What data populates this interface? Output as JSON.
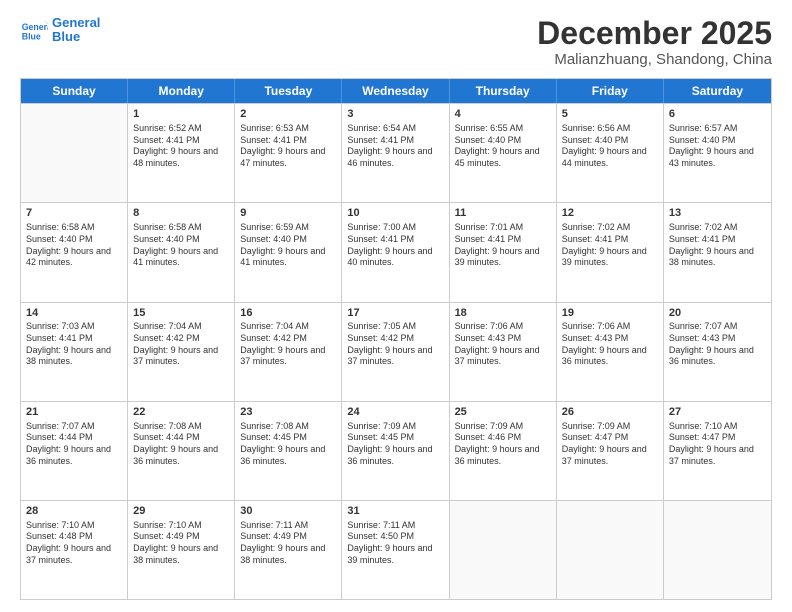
{
  "header": {
    "logo_line1": "General",
    "logo_line2": "Blue",
    "main_title": "December 2025",
    "subtitle": "Malianzhuang, Shandong, China"
  },
  "days_of_week": [
    "Sunday",
    "Monday",
    "Tuesday",
    "Wednesday",
    "Thursday",
    "Friday",
    "Saturday"
  ],
  "weeks": [
    [
      {
        "day": "",
        "empty": true
      },
      {
        "day": "1",
        "sunrise": "6:52 AM",
        "sunset": "4:41 PM",
        "daylight": "9 hours and 48 minutes."
      },
      {
        "day": "2",
        "sunrise": "6:53 AM",
        "sunset": "4:41 PM",
        "daylight": "9 hours and 47 minutes."
      },
      {
        "day": "3",
        "sunrise": "6:54 AM",
        "sunset": "4:41 PM",
        "daylight": "9 hours and 46 minutes."
      },
      {
        "day": "4",
        "sunrise": "6:55 AM",
        "sunset": "4:40 PM",
        "daylight": "9 hours and 45 minutes."
      },
      {
        "day": "5",
        "sunrise": "6:56 AM",
        "sunset": "4:40 PM",
        "daylight": "9 hours and 44 minutes."
      },
      {
        "day": "6",
        "sunrise": "6:57 AM",
        "sunset": "4:40 PM",
        "daylight": "9 hours and 43 minutes."
      }
    ],
    [
      {
        "day": "7",
        "sunrise": "6:58 AM",
        "sunset": "4:40 PM",
        "daylight": "9 hours and 42 minutes."
      },
      {
        "day": "8",
        "sunrise": "6:58 AM",
        "sunset": "4:40 PM",
        "daylight": "9 hours and 41 minutes."
      },
      {
        "day": "9",
        "sunrise": "6:59 AM",
        "sunset": "4:40 PM",
        "daylight": "9 hours and 41 minutes."
      },
      {
        "day": "10",
        "sunrise": "7:00 AM",
        "sunset": "4:41 PM",
        "daylight": "9 hours and 40 minutes."
      },
      {
        "day": "11",
        "sunrise": "7:01 AM",
        "sunset": "4:41 PM",
        "daylight": "9 hours and 39 minutes."
      },
      {
        "day": "12",
        "sunrise": "7:02 AM",
        "sunset": "4:41 PM",
        "daylight": "9 hours and 39 minutes."
      },
      {
        "day": "13",
        "sunrise": "7:02 AM",
        "sunset": "4:41 PM",
        "daylight": "9 hours and 38 minutes."
      }
    ],
    [
      {
        "day": "14",
        "sunrise": "7:03 AM",
        "sunset": "4:41 PM",
        "daylight": "9 hours and 38 minutes."
      },
      {
        "day": "15",
        "sunrise": "7:04 AM",
        "sunset": "4:42 PM",
        "daylight": "9 hours and 37 minutes."
      },
      {
        "day": "16",
        "sunrise": "7:04 AM",
        "sunset": "4:42 PM",
        "daylight": "9 hours and 37 minutes."
      },
      {
        "day": "17",
        "sunrise": "7:05 AM",
        "sunset": "4:42 PM",
        "daylight": "9 hours and 37 minutes."
      },
      {
        "day": "18",
        "sunrise": "7:06 AM",
        "sunset": "4:43 PM",
        "daylight": "9 hours and 37 minutes."
      },
      {
        "day": "19",
        "sunrise": "7:06 AM",
        "sunset": "4:43 PM",
        "daylight": "9 hours and 36 minutes."
      },
      {
        "day": "20",
        "sunrise": "7:07 AM",
        "sunset": "4:43 PM",
        "daylight": "9 hours and 36 minutes."
      }
    ],
    [
      {
        "day": "21",
        "sunrise": "7:07 AM",
        "sunset": "4:44 PM",
        "daylight": "9 hours and 36 minutes."
      },
      {
        "day": "22",
        "sunrise": "7:08 AM",
        "sunset": "4:44 PM",
        "daylight": "9 hours and 36 minutes."
      },
      {
        "day": "23",
        "sunrise": "7:08 AM",
        "sunset": "4:45 PM",
        "daylight": "9 hours and 36 minutes."
      },
      {
        "day": "24",
        "sunrise": "7:09 AM",
        "sunset": "4:45 PM",
        "daylight": "9 hours and 36 minutes."
      },
      {
        "day": "25",
        "sunrise": "7:09 AM",
        "sunset": "4:46 PM",
        "daylight": "9 hours and 36 minutes."
      },
      {
        "day": "26",
        "sunrise": "7:09 AM",
        "sunset": "4:47 PM",
        "daylight": "9 hours and 37 minutes."
      },
      {
        "day": "27",
        "sunrise": "7:10 AM",
        "sunset": "4:47 PM",
        "daylight": "9 hours and 37 minutes."
      }
    ],
    [
      {
        "day": "28",
        "sunrise": "7:10 AM",
        "sunset": "4:48 PM",
        "daylight": "9 hours and 37 minutes."
      },
      {
        "day": "29",
        "sunrise": "7:10 AM",
        "sunset": "4:49 PM",
        "daylight": "9 hours and 38 minutes."
      },
      {
        "day": "30",
        "sunrise": "7:11 AM",
        "sunset": "4:49 PM",
        "daylight": "9 hours and 38 minutes."
      },
      {
        "day": "31",
        "sunrise": "7:11 AM",
        "sunset": "4:50 PM",
        "daylight": "9 hours and 39 minutes."
      },
      {
        "day": "",
        "empty": true
      },
      {
        "day": "",
        "empty": true
      },
      {
        "day": "",
        "empty": true
      }
    ]
  ]
}
